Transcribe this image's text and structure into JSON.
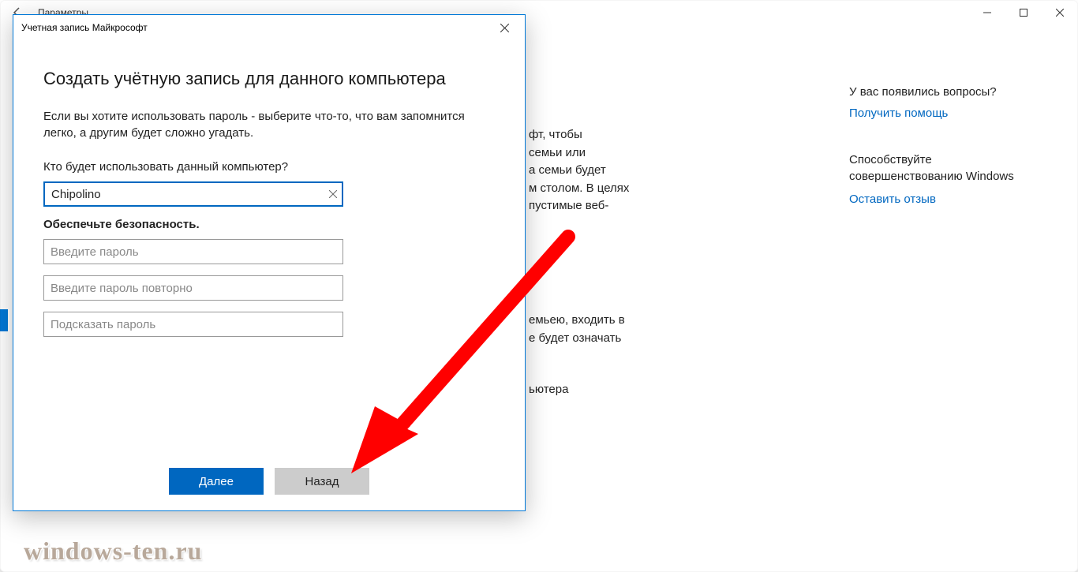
{
  "settings": {
    "title": "Параметры",
    "win_controls": {
      "min": "—",
      "max": "☐",
      "close": "✕"
    }
  },
  "bg": {
    "l1": "фт, чтобы",
    "l2": "семьи или",
    "l3": "а семьи будет",
    "l4": "м столом. В целях",
    "l5": "пустимые веб-",
    "b2l1": "емьею, входить в",
    "b2l2": "е будет означать",
    "b3": "ьютера"
  },
  "side": {
    "q": "У вас появились вопросы?",
    "help": "Получить помощь",
    "contrib": "Способствуйте совершенствованию Windows",
    "feedback": "Оставить отзыв"
  },
  "dialog": {
    "title": "Учетная запись Майкрософт",
    "heading": "Создать учётную запись для данного компьютера",
    "desc": "Если вы хотите использовать пароль - выберите что-то, что вам запомнится легко, а другим будет сложно угадать.",
    "who_label": "Кто будет использовать данный компьютер?",
    "username_value": "Chipolino",
    "secure_label": "Обеспечьте безопасность.",
    "pwd_placeholder": "Введите пароль",
    "pwd2_placeholder": "Введите пароль повторно",
    "hint_placeholder": "Подсказать пароль",
    "next": "Далее",
    "back": "Назад"
  },
  "watermark": "windows-ten.ru"
}
